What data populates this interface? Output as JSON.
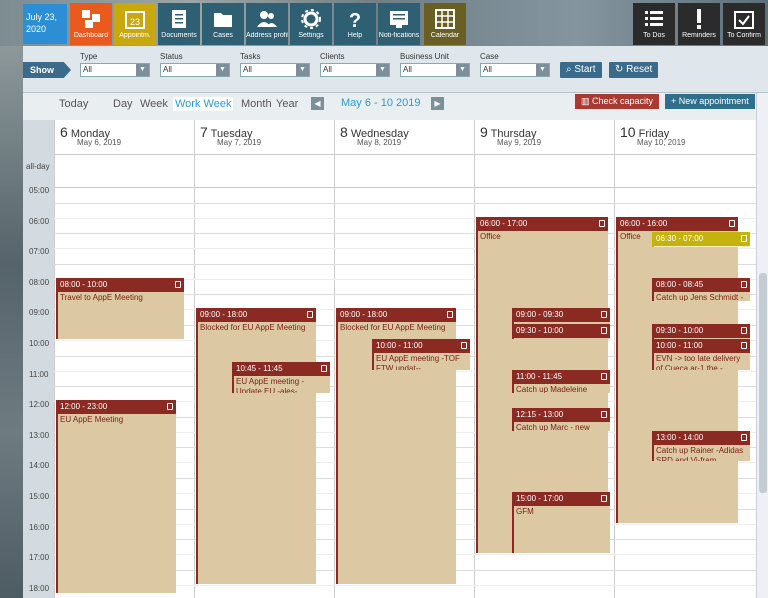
{
  "header": {
    "date_line1": "July 23,",
    "date_line2": "2020",
    "tiles": [
      {
        "label": "Dashboard",
        "icon": "dashboard-icon",
        "color": "#e85a1e"
      },
      {
        "label": "Appointm.",
        "icon": "calendar-23-icon",
        "color": "#c9a70f"
      },
      {
        "label": "Documents",
        "icon": "document-icon",
        "color": "#2f5f73"
      },
      {
        "label": "Cases",
        "icon": "folder-icon",
        "color": "#2f5f73"
      },
      {
        "label": "Address profiles",
        "icon": "people-icon",
        "color": "#2f5f73"
      },
      {
        "label": "Settings",
        "icon": "gear-icon",
        "color": "#2f5f73"
      },
      {
        "label": "Help",
        "icon": "question-icon",
        "color": "#2f5f73"
      },
      {
        "label": "Noti-fications",
        "icon": "notification-icon",
        "color": "#2f5f73"
      },
      {
        "label": "Calendar",
        "icon": "grid-calendar-icon",
        "color": "#6a5f23"
      },
      {
        "label": "To Dos",
        "icon": "list-icon",
        "color": "#2b2b2b"
      },
      {
        "label": "Reminders",
        "icon": "exclamation-icon",
        "color": "#2b2b2b"
      },
      {
        "label": "To Confirm",
        "icon": "calendar-check-icon",
        "color": "#2b2b2b"
      }
    ]
  },
  "filters": {
    "show_label": "Show",
    "items": [
      {
        "label": "Type",
        "value": "All"
      },
      {
        "label": "Status",
        "value": "All"
      },
      {
        "label": "Tasks",
        "value": "All"
      },
      {
        "label": "Clients",
        "value": "All"
      },
      {
        "label": "Business Unit",
        "value": "All"
      },
      {
        "label": "Case",
        "value": "All"
      }
    ],
    "start_label": "Start",
    "reset_label": "Reset"
  },
  "calendar": {
    "views": [
      "Today",
      "Day",
      "Week",
      "Work Week",
      "Month",
      "Year"
    ],
    "active_view": "Work Week",
    "date_range": "May 6 - 10 2019",
    "check_capacity": "Check capacity",
    "new_appointment": "+ New appointment",
    "allday_label": "all-day",
    "hours": [
      "05:00",
      "06:00",
      "07:00",
      "08:00",
      "09:00",
      "10:00",
      "11:00",
      "12:00",
      "13:00",
      "14:00",
      "15:00",
      "16:00",
      "17:00",
      "18:00"
    ],
    "days": [
      {
        "num": "6",
        "name": "Monday",
        "date": "May 6, 2019"
      },
      {
        "num": "7",
        "name": "Tuesday",
        "date": "May 7, 2019"
      },
      {
        "num": "8",
        "name": "Wednesday",
        "date": "May 8, 2019"
      },
      {
        "num": "9",
        "name": "Thursday",
        "date": "May 9, 2019"
      },
      {
        "num": "10",
        "name": "Friday",
        "date": "May 10, 2019"
      }
    ],
    "appointments": [
      {
        "day": 0,
        "time": "08:00 - 10:00",
        "title": "Travel to AppE Meeting"
      },
      {
        "day": 0,
        "time": "12:00 - 23:00",
        "title": "EU AppE Meeting"
      },
      {
        "day": 1,
        "time": "09:00 - 18:00",
        "title": "Blocked for EU AppE Meeting"
      },
      {
        "day": 1,
        "time": "10:45 - 11:45",
        "title": "EU AppE meeting - Update EU -ales-"
      },
      {
        "day": 2,
        "time": "09:00 - 18:00",
        "title": "Blocked for EU AppE Meeting"
      },
      {
        "day": 2,
        "time": "10:00 - 11:00",
        "title": "EU AppE meeting -TOF FTW updat--"
      },
      {
        "day": 3,
        "time": "06:00 - 17:00",
        "title": "Office"
      },
      {
        "day": 3,
        "time": "09:00 - 09:30",
        "title": ""
      },
      {
        "day": 3,
        "time": "09:30 - 10:00",
        "title": ""
      },
      {
        "day": 3,
        "time": "11:00 - 11:45",
        "title": "Catch up Madeleine"
      },
      {
        "day": 3,
        "time": "12:15 - 13:00",
        "title": "Catch up Marc - new"
      },
      {
        "day": 3,
        "time": "15:00 - 17:00",
        "title": "GFM"
      },
      {
        "day": 4,
        "time": "06:00 - 16:00",
        "title": "Office"
      },
      {
        "day": 4,
        "time": "06:30 - 07:00",
        "title": ""
      },
      {
        "day": 4,
        "time": "08:00 - 08:45",
        "title": "Catch up Jens Schmidt -"
      },
      {
        "day": 4,
        "time": "09:30 - 10:00",
        "title": ""
      },
      {
        "day": 4,
        "time": "10:00 - 11:00",
        "title": "EVN -> too late delivery of Cueca ar-1 the -"
      },
      {
        "day": 4,
        "time": "13:00 - 14:00",
        "title": "Catch up Rainer -Adidas SRD and Vi-fram"
      }
    ]
  }
}
